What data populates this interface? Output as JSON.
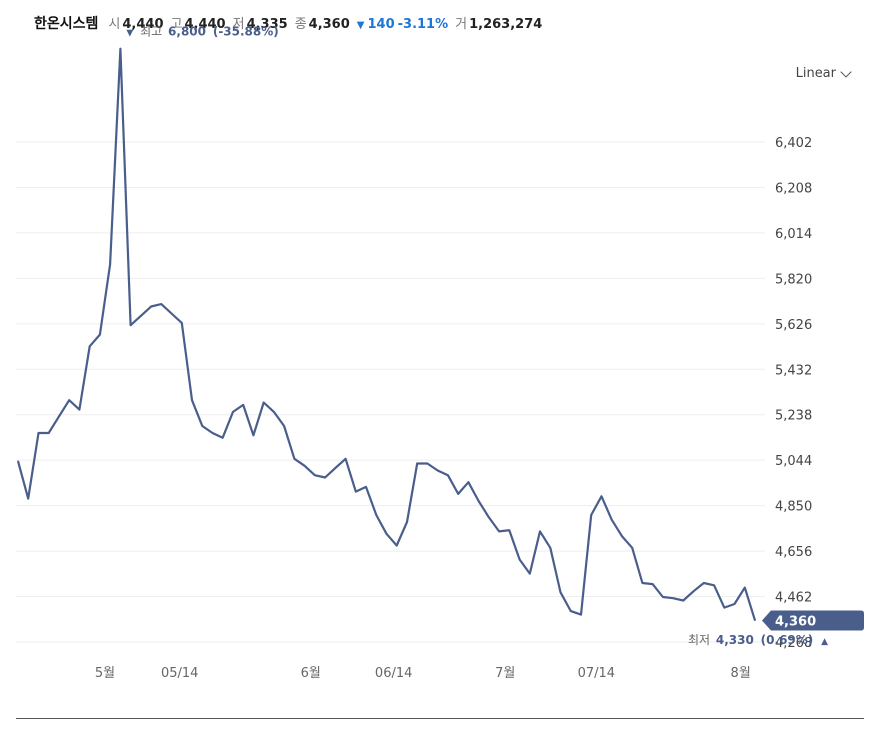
{
  "header": {
    "name": "한온시스템",
    "open_label": "시",
    "open": "4,440",
    "high_label": "고",
    "high": "4,440",
    "low_label": "저",
    "low": "4,335",
    "close_label": "종",
    "close": "4,360",
    "change_arrow": "▼",
    "change": "140",
    "change_pct": "-3.11%",
    "volume_label": "거",
    "volume": "1,263,274"
  },
  "scale_selector": {
    "label": "Linear",
    "icon": "chevron-down-icon"
  },
  "colors": {
    "line": "#4a5e8c",
    "badge": "#4a5e8c",
    "down": "#1e76d6",
    "grid": "#eeeeee"
  },
  "chart_data": {
    "type": "line",
    "x_labels": [
      "5월",
      "05/14",
      "6월",
      "06/14",
      "7월",
      "07/14",
      "8월"
    ],
    "y_ticks": [
      6402,
      6208,
      6014,
      5820,
      5626,
      5432,
      5238,
      5044,
      4850,
      4656,
      4462,
      4268
    ],
    "y_tick_labels": [
      "6,402",
      "6,208",
      "6,014",
      "5,820",
      "5,626",
      "5,432",
      "5,238",
      "5,044",
      "4,850",
      "4,656",
      "4,462",
      "4,268"
    ],
    "ylim": [
      4220,
      6540
    ],
    "series": [
      {
        "values": [
          5040,
          4880,
          5160,
          5160,
          5230,
          5300,
          5260,
          5530,
          5580,
          5880,
          6800,
          5620,
          5660,
          5700,
          5710,
          5670,
          5630,
          5300,
          5190,
          5160,
          5140,
          5250,
          5280,
          5150,
          5290,
          5250,
          5190,
          5050,
          5020,
          4980,
          4970,
          5010,
          5050,
          4910,
          4930,
          4810,
          4730,
          4680,
          4780,
          5030,
          5030,
          5000,
          4980,
          4900,
          4950,
          4870,
          4800,
          4740,
          4745,
          4620,
          4560,
          4740,
          4670,
          4480,
          4400,
          4385,
          4810,
          4890,
          4790,
          4720,
          4670,
          4520,
          4515,
          4460,
          4455,
          4445,
          4485,
          4520,
          4510,
          4415,
          4430,
          4500,
          4360
        ]
      }
    ],
    "high_marker": {
      "arrow": "▼",
      "label": "최고",
      "value": "6,800",
      "pct": "(-35.88%)"
    },
    "low_marker": {
      "label": "최저",
      "value": "4,330",
      "pct": "(0.69%)",
      "arrow": "▲"
    },
    "last_price_badge": "4,360"
  }
}
